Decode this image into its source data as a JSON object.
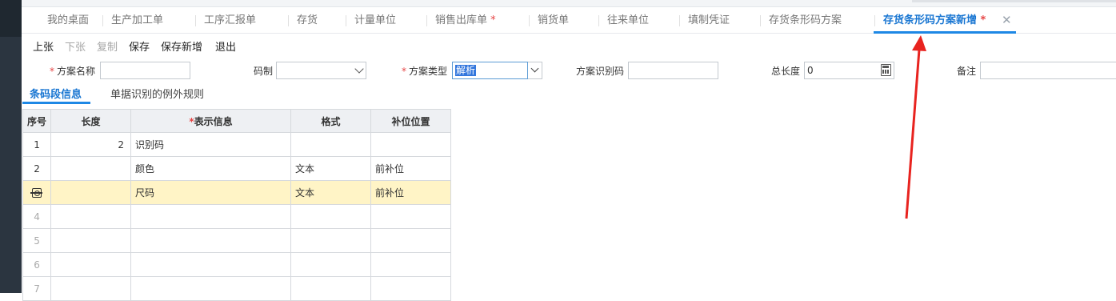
{
  "tabs": [
    {
      "label": "我的桌面",
      "star": ""
    },
    {
      "label": "生产加工单",
      "star": ""
    },
    {
      "label": "工序汇报单",
      "star": ""
    },
    {
      "label": "存货",
      "star": ""
    },
    {
      "label": "计量单位",
      "star": ""
    },
    {
      "label": "销售出库单",
      "star": "*"
    },
    {
      "label": "销货单",
      "star": ""
    },
    {
      "label": "往来单位",
      "star": ""
    },
    {
      "label": "填制凭证",
      "star": ""
    },
    {
      "label": "存货条形码方案",
      "star": ""
    },
    {
      "label": "存货条形码方案新增",
      "star": "*"
    }
  ],
  "close_glyph": "✕",
  "toolbar": {
    "prev": "上张",
    "next": "下张",
    "copy": "复制",
    "save": "保存",
    "save_new": "保存新增",
    "exit": "退出"
  },
  "form": {
    "scheme_name_label": "方案名称",
    "scheme_name_value": "",
    "code_system_label": "码制",
    "code_system_value": "",
    "scheme_type_label": "方案类型",
    "scheme_type_value": "解析",
    "scheme_id_label": "方案识别码",
    "scheme_id_value": "",
    "total_length_label": "总长度",
    "total_length_value": "0",
    "remark_label": "备注",
    "remark_value": "",
    "required_mark": "*"
  },
  "subtabs": {
    "segment_info": "条码段信息",
    "exception_rules": "单据识别的例外规则"
  },
  "grid": {
    "headers": {
      "no": "序号",
      "length": "长度",
      "info": "表示信息",
      "format": "格式",
      "pad": "补位位置",
      "required_mark": "*"
    },
    "rows": [
      {
        "no": "1",
        "length": "2",
        "info": "识别码",
        "format": "",
        "pad": ""
      },
      {
        "no": "2",
        "length": "",
        "info": "颜色",
        "format": "文本",
        "pad": "前补位"
      },
      {
        "no": "",
        "length": "",
        "info": "尺码",
        "format": "文本",
        "pad": "前补位"
      },
      {
        "no": "4",
        "length": "",
        "info": "",
        "format": "",
        "pad": ""
      },
      {
        "no": "5",
        "length": "",
        "info": "",
        "format": "",
        "pad": ""
      },
      {
        "no": "6",
        "length": "",
        "info": "",
        "format": "",
        "pad": ""
      },
      {
        "no": "7",
        "length": "",
        "info": "",
        "format": "",
        "pad": ""
      }
    ]
  },
  "colors": {
    "accent": "#1e88e5",
    "required": "#e64545",
    "selected_row": "#fff4c6",
    "annotation_arrow": "#e8231f"
  },
  "icons": [
    "close-icon",
    "dropdown-arrow-icon",
    "calculator-icon",
    "row-settings-icon",
    "annotation-arrow"
  ]
}
